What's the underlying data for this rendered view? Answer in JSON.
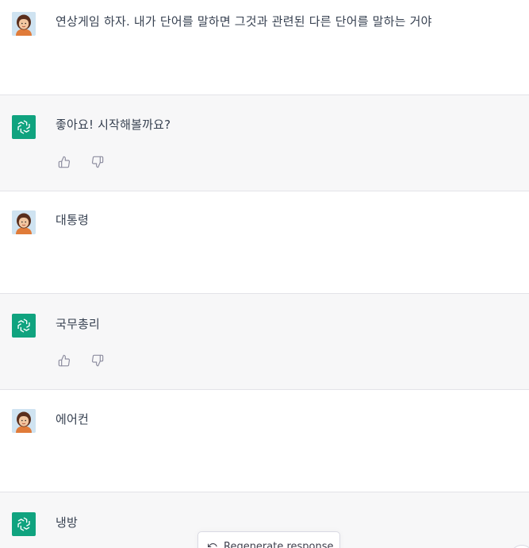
{
  "messages": [
    {
      "role": "user",
      "text": "연상게임 하자. 내가 단어를 말하면 그것과 관련된 다른 단어를 말하는 거야"
    },
    {
      "role": "assistant",
      "text": "좋아요! 시작해볼까요?"
    },
    {
      "role": "user",
      "text": "대통령"
    },
    {
      "role": "assistant",
      "text": "국무총리"
    },
    {
      "role": "user",
      "text": "에어컨"
    },
    {
      "role": "assistant",
      "text": "냉방"
    }
  ],
  "regenerate_label": "Regenerate response",
  "icons": {
    "user_avatar": "user-avatar-icon",
    "assistant_avatar": "openai-logo-icon",
    "thumbs_up": "thumbs-up-icon",
    "thumbs_down": "thumbs-down-icon",
    "regenerate": "refresh-icon"
  },
  "colors": {
    "assistant_background": "#f7f7f8",
    "assistant_avatar": "#10a37f",
    "text": "#374151"
  }
}
